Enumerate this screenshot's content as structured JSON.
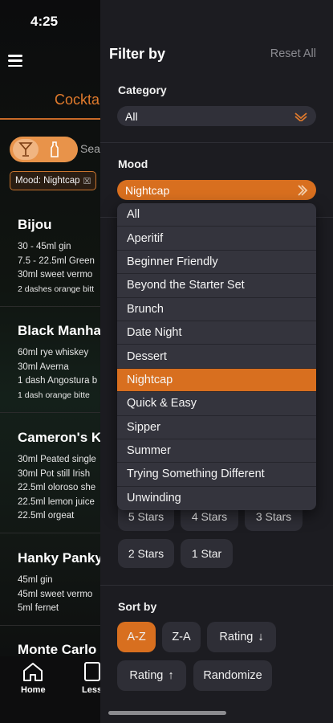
{
  "status": {
    "time": "4:25"
  },
  "background": {
    "title": "Cockta",
    "search_label": "Sea",
    "mood_chip": "Mood: Nightcap",
    "cards": [
      {
        "name": "Bijou",
        "ingredients": [
          "30 - 45ml gin",
          "7.5 - 22.5ml Green",
          "30ml sweet vermo",
          "2 dashes orange bitt"
        ]
      },
      {
        "name": "Black Manha",
        "ingredients": [
          "60ml rye whiskey",
          "30ml Averna",
          "1 dash Angostura b",
          "1 dash orange bitte"
        ]
      },
      {
        "name": "Cameron's K",
        "ingredients": [
          "30ml Peated single",
          "30ml Pot still Irish",
          "22.5ml oloroso she",
          "22.5ml lemon juice",
          "22.5ml orgeat"
        ]
      },
      {
        "name": "Hanky Panky",
        "ingredients": [
          "45ml gin",
          "45ml sweet vermo",
          "5ml fernet"
        ]
      },
      {
        "name": "Monte Carlo",
        "ingredients": []
      }
    ],
    "tabs": [
      {
        "label": "Home"
      },
      {
        "label": "Less"
      }
    ]
  },
  "drawer": {
    "title": "Filter by",
    "reset_label": "Reset All",
    "category": {
      "label": "Category",
      "value": "All"
    },
    "mood": {
      "label": "Mood",
      "value": "Nightcap",
      "options": [
        "All",
        "Aperitif",
        "Beginner Friendly",
        "Beyond the Starter Set",
        "Brunch",
        "Date Night",
        "Dessert",
        "Nightcap",
        "Quick & Easy",
        "Sipper",
        "Summer",
        "Trying Something Different",
        "Unwinding"
      ],
      "selected_index": 7
    },
    "rating": {
      "options": [
        "5 Stars",
        "4 Stars",
        "3 Stars",
        "2 Stars",
        "1 Star"
      ]
    },
    "sort": {
      "label": "Sort by",
      "options": [
        "A-Z",
        "Z-A",
        "Rating",
        "Rating",
        "Randomize"
      ],
      "arrows": [
        "",
        "",
        "↓",
        "↑",
        ""
      ],
      "selected_index": 0
    }
  },
  "colors": {
    "accent": "#d86f1f",
    "drawer_bg": "#1c1c21",
    "control_bg": "#303039"
  }
}
